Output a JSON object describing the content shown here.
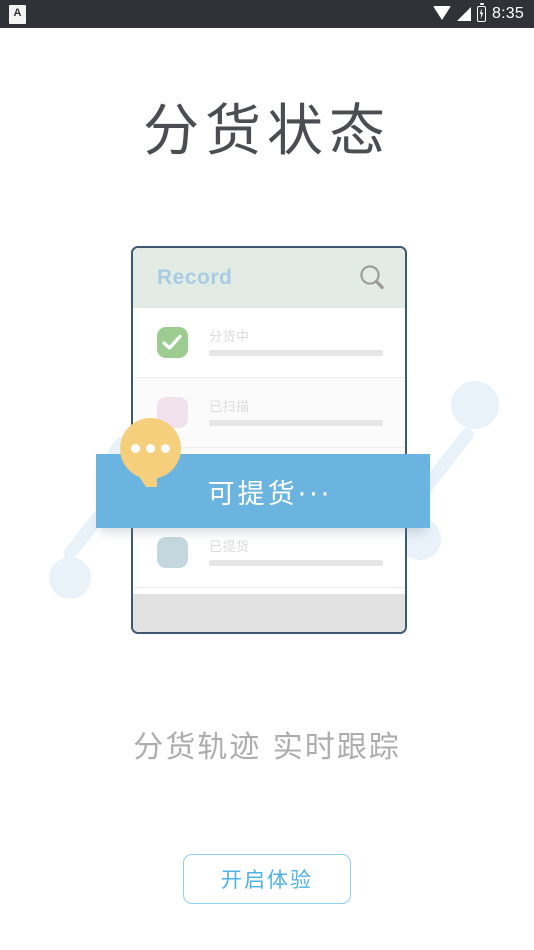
{
  "statusbar": {
    "app_icon": "app-badge-icon",
    "app_icon_letter": "A",
    "wifi_icon": "wifi-icon",
    "signal_icon": "cellular-signal-icon",
    "battery_icon": "battery-charging-icon",
    "time": "8:35"
  },
  "page": {
    "title": "分货状态",
    "subtitle": "分货轨迹  实时跟踪"
  },
  "illustration": {
    "card": {
      "header_title": "Record",
      "search_icon": "search-icon",
      "rows": [
        {
          "label": "分货中",
          "box_color": "#9ccc8f",
          "state": "checked"
        },
        {
          "label": "已扫描",
          "box_color": "#f1e1ec",
          "state": "unchecked"
        },
        {
          "label": "已提货",
          "box_color": "#c4d7de",
          "state": "unchecked"
        }
      ]
    },
    "banner": {
      "text": "可提货···",
      "color": "#6cb4e0"
    },
    "bubble": {
      "icon": "chat-dots-icon",
      "color": "#f6cf7c",
      "dots": 3
    },
    "decorations": {
      "color": "#e9f2f9",
      "connectors": 2
    }
  },
  "cta": {
    "label": "开启体验",
    "border_color": "#8ed2f0",
    "text_color": "#4eb3e4"
  }
}
